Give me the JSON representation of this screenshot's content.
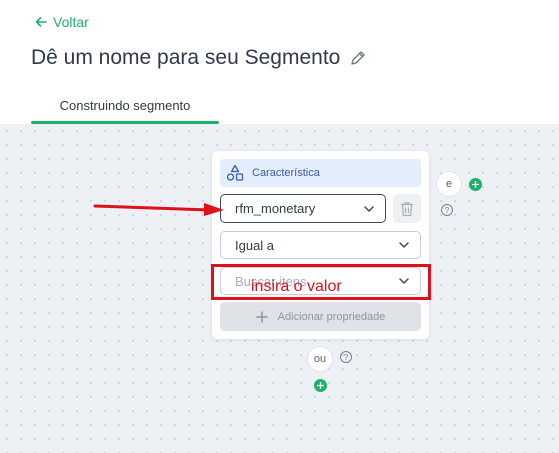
{
  "header": {
    "back_label": "Voltar",
    "title": "Dê um nome para seu Segmento"
  },
  "tabs": [
    {
      "label": "Construindo segmento",
      "active": true
    }
  ],
  "card": {
    "section_label": "Característica",
    "property_select": "rfm_monetary",
    "operator_select": "Igual a",
    "value_placeholder": "Buscar itens",
    "add_property_label": "Adicionar propriedade"
  },
  "connectors": {
    "and_label": "e",
    "or_label": "ou",
    "help_glyph": "?"
  },
  "annotation": {
    "text": "insira o valor",
    "color": "#e0101a"
  },
  "colors": {
    "accent": "#1fb16a",
    "section_bg": "#e3edfb",
    "section_text": "#3c5aa6"
  }
}
